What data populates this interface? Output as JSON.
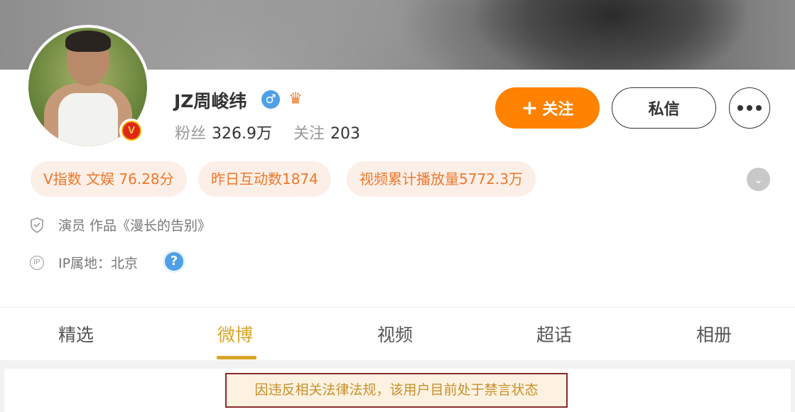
{
  "profile": {
    "name": "JZ周峻纬",
    "gender_icon": "male-icon",
    "member_icon": "crown-icon",
    "verified_badge": "V",
    "fans_label": "粉丝",
    "fans_value": "326.9万",
    "following_label": "关注",
    "following_value": "203"
  },
  "actions": {
    "follow_plus": "+",
    "follow_label": "关注",
    "message_label": "私信",
    "more_icon": "more-dots-icon"
  },
  "pills": [
    "V指数 文娱 76.28分",
    "昨日互动数1874",
    "视频累计播放量5772.3万"
  ],
  "info": {
    "occupation": "演员 作品《漫长的告别》",
    "ip_location": "IP属地：北京",
    "ip_icon_text": "IP",
    "help_icon_text": "?"
  },
  "tabs": [
    {
      "label": "精选"
    },
    {
      "label": "微博"
    },
    {
      "label": "视频"
    },
    {
      "label": "超话"
    },
    {
      "label": "相册"
    }
  ],
  "active_tab": "微博",
  "notice": "因违反相关法律法规，该用户目前处于禁言状态",
  "colors": {
    "accent": "#ff8200",
    "tab_active": "#d8a628",
    "pill_text": "#f0772a",
    "notice_text": "#c9902a"
  }
}
